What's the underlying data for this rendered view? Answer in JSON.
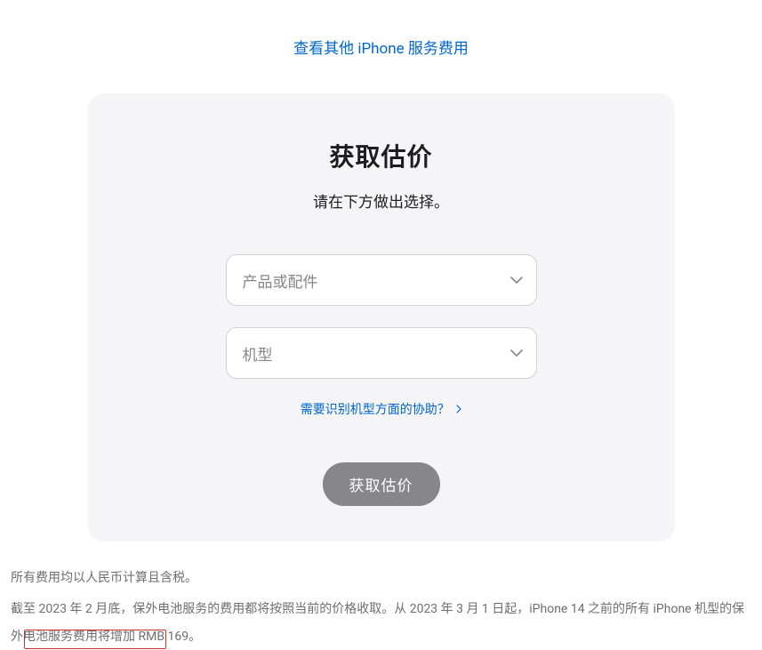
{
  "topLink": {
    "label": "查看其他 iPhone 服务费用"
  },
  "card": {
    "title": "获取估价",
    "subtitle": "请在下方做出选择。",
    "productSelect": {
      "placeholder": "产品或配件"
    },
    "modelSelect": {
      "placeholder": "机型"
    },
    "helpLink": {
      "label": "需要识别机型方面的协助？"
    },
    "submitButton": {
      "label": "获取估价"
    }
  },
  "footer": {
    "line1": "所有费用均以人民币计算且含税。",
    "line2": "截至 2023 年 2 月底，保外电池服务的费用都将按照当前的价格收取。从 2023 年 3 月 1 日起，iPhone 14 之前的所有 iPhone 机型的保外电池服务费用将增加 RMB 169。"
  }
}
